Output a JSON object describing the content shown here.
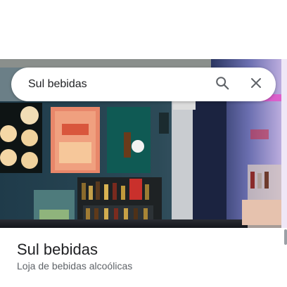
{
  "search": {
    "query": "Sul bebidas"
  },
  "place": {
    "name": "Sul bebidas",
    "category": "Loja de bebidas alcoólicas"
  },
  "icons": {
    "search": "search-icon",
    "close": "close-icon"
  },
  "colors": {
    "text_primary": "#202124",
    "text_secondary": "#5f6368",
    "icon": "#5f6368"
  }
}
